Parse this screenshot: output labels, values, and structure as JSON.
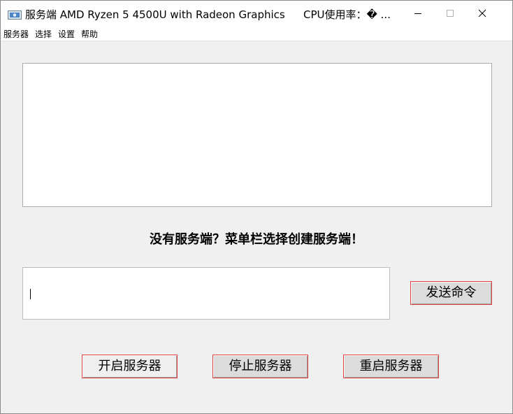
{
  "window": {
    "title": "服务端 AMD Ryzen 5 4500U with Radeon Graphics",
    "cpu_label": "CPU使用率：� ..."
  },
  "menu": {
    "items": [
      {
        "label": "服务器"
      },
      {
        "label": "选择"
      },
      {
        "label": "设置"
      },
      {
        "label": "帮助"
      }
    ]
  },
  "output": {
    "text": ""
  },
  "status": {
    "message": "没有服务端？菜单栏选择创建服务端！"
  },
  "command": {
    "value": "",
    "send_label": "发送命令"
  },
  "controls": {
    "start_label": "开启服务器",
    "stop_label": "停止服务器",
    "restart_label": "重启服务器"
  },
  "colors": {
    "button_border": "#e04040",
    "background": "#f0f0f0"
  }
}
